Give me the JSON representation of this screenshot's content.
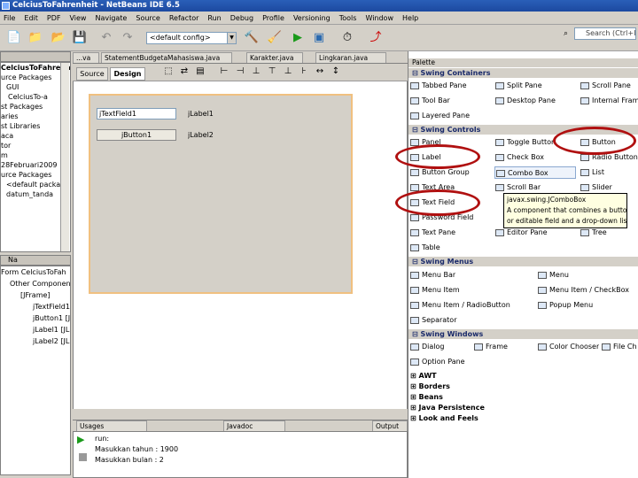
{
  "app": {
    "title": "CelciusToFahrenheit - NetBeans IDE 6.5"
  },
  "menu": [
    "File",
    "Edit",
    "PDF",
    "View",
    "Navigate",
    "Source",
    "Refactor",
    "Run",
    "Debug",
    "Profile",
    "Versioning",
    "Tools",
    "Window",
    "Help"
  ],
  "toolbar": {
    "config_value": "<default config>",
    "search_placeholder": "Search (Ctrl+I)"
  },
  "projects": {
    "nodes": [
      "CelciusToFahrenheit",
      "urce Packages",
      "GUI",
      "CelciusTo-a",
      "st Packages",
      "aries",
      "st Libraries",
      "aca",
      "tor",
      "m",
      "28Februari2009",
      "urce Packages",
      "<default packag",
      "datum_tanda"
    ]
  },
  "navigator": {
    "title": "Na",
    "items": [
      "Form CelciusToFah",
      "Other Components",
      "[JFrame]",
      "jTextField1",
      "jButton1 [J",
      "jLabel1 [JL",
      "jLabel2 [JL"
    ]
  },
  "editor": {
    "tabs": [
      "...va",
      "StatementBudgetaMahasiswa.java",
      "Karakter.java",
      "Lingkaran.java"
    ],
    "source_tab": "Source",
    "design_tab": "Design"
  },
  "form": {
    "textfield": "jTextField1",
    "button": "jButton1",
    "label1": "jLabel1",
    "label2": "jLabel2"
  },
  "output": {
    "tabs": [
      "Usages",
      "Javadoc",
      "Output"
    ],
    "lines": [
      "run:",
      "Masukkan tahun : 1900",
      "Masukkan bulan : 2"
    ]
  },
  "palette": {
    "title": "Palette",
    "categories": {
      "containers": "Swing Containers",
      "controls": "Swing Controls",
      "menus": "Swing Menus",
      "windows": "Swing Windows"
    },
    "containers": [
      "Tabbed Pane",
      "Split Pane",
      "Scroll Pane",
      "Tool Bar",
      "Desktop Pane",
      "Internal Frame",
      "Layered Pane"
    ],
    "controls": [
      "Panel",
      "Toggle Button",
      "Button",
      "Label",
      "Check Box",
      "Radio Button",
      "Button Group",
      "Combo Box",
      "List",
      "Text Area",
      "Scroll Bar",
      "Slider",
      "Text Field",
      "Password Field",
      "Text Pane",
      "Editor Pane",
      "Tree",
      "Table"
    ],
    "menus": [
      "Menu Bar",
      "Menu",
      "Menu Item",
      "Menu Item / CheckBox",
      "Menu Item / RadioButton",
      "Popup Menu",
      "Separator"
    ],
    "windows": [
      "Dialog",
      "Frame",
      "Color Chooser",
      "File Ch",
      "Option Pane"
    ],
    "collapsed": [
      "AWT",
      "Borders",
      "Beans",
      "Java Persistence",
      "Look and Feels"
    ]
  },
  "tooltip": {
    "line1": "javax.swing.JComboBox",
    "line2": "A component that combines a button",
    "line3": "or editable field and a drop-down list"
  },
  "highlight_color": "#b01010"
}
